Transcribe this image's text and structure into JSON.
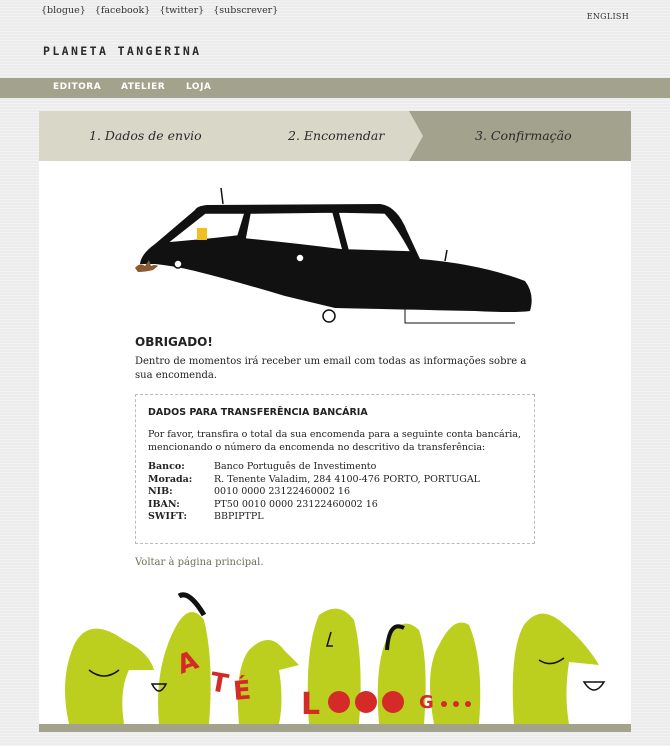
{
  "header": {
    "links": [
      "{blogue}",
      "{facebook}",
      "{twitter}",
      "{subscrever}"
    ],
    "language": "ENGLISH",
    "logo": "PLANETA TANGERINA"
  },
  "nav": {
    "items": [
      "EDITORA",
      "ATELIER",
      "LOJA"
    ]
  },
  "steps": [
    "1. Dados de envio",
    "2. Encomendar",
    "3. Confirmação"
  ],
  "confirmation": {
    "title": "OBRIGADO!",
    "message": "Dentro de momentos irá receber um email com todas as informações sobre a sua encomenda."
  },
  "bank": {
    "title": "DADOS PARA TRANSFERÊNCIA BANCÁRIA",
    "instructions": "Por favor, transfira o total da sua encomenda para a seguinte conta bancária, mencionando o número da encomenda no descritivo da transferência:",
    "rows": [
      {
        "label": "Banco:",
        "value": "Banco Português de Investimento"
      },
      {
        "label": "Morada:",
        "value": "R. Tenente Valadim, 284 4100-476 PORTO, PORTUGAL"
      },
      {
        "label": "NIB:",
        "value": "0010 0000 23122460002 16"
      },
      {
        "label": "IBAN:",
        "value": "PT50 0010 0000 23122460002 16"
      },
      {
        "label": "SWIFT:",
        "value": "BBPIPTPL"
      }
    ]
  },
  "back_link": "Voltar à página principal.",
  "illustration_text": "ATÉ LOOOG...",
  "colors": {
    "nav": "#a3a28c",
    "step_light": "#d9d8c8",
    "step_dark": "#a3a28c",
    "creature": "#bccf1e",
    "lettering": "#d42a28"
  }
}
